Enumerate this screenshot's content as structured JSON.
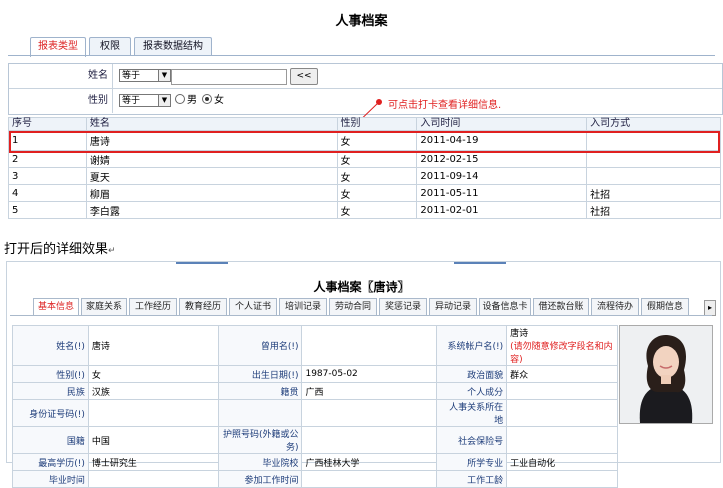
{
  "page_title": "人事档案",
  "tabs": [
    "报表类型",
    "权限",
    "报表数据结构"
  ],
  "search": {
    "name_label": "姓名",
    "name_op": "等于",
    "name_btn": "<<",
    "gender_label": "性别",
    "gender_op": "等于",
    "gender_male": "男",
    "gender_female": "女"
  },
  "callout": "可点击打卡查看详细信息.",
  "table": {
    "headers": [
      "序号",
      "姓名",
      "性别",
      "入司时间",
      "入司方式"
    ],
    "rows": [
      [
        "1",
        "唐诗",
        "女",
        "2011-04-19",
        ""
      ],
      [
        "2",
        "谢婧",
        "女",
        "2012-02-15",
        ""
      ],
      [
        "3",
        "夏天",
        "女",
        "2011-09-14",
        ""
      ],
      [
        "4",
        "柳眉",
        "女",
        "2011-05-11",
        "社招"
      ],
      [
        "5",
        "李白露",
        "女",
        "2011-02-01",
        "社招"
      ]
    ]
  },
  "caption": "打开后的详细效果",
  "detail": {
    "title": "人事档案〖唐诗〗",
    "tabs": [
      "基本信息",
      "家庭关系",
      "工作经历",
      "教育经历",
      "个人证书",
      "培训记录",
      "劳动合同",
      "奖惩记录",
      "异动记录",
      "设备信息卡",
      "借还款台账",
      "流程待办",
      "假期信息"
    ],
    "scroll_arrow": "▸",
    "rows": [
      {
        "l1": "姓名(!)",
        "v1": "唐诗",
        "l2": "曾用名(!)",
        "v2": "",
        "l3": "系统帐户名(!)",
        "v3": "唐诗",
        "v3_note": "(请勿随意修改字段名和内容)"
      },
      {
        "l1": "性别(!)",
        "v1": "女",
        "l2": "出生日期(!)",
        "v2": "1987-05-02",
        "l3": "政治面貌",
        "v3": "群众"
      },
      {
        "l1": "民族",
        "v1": "汉族",
        "l2": "籍贯",
        "v2": "广西",
        "l3": "个人成分",
        "v3": ""
      },
      {
        "l1": "身份证号码(!)",
        "v1": "",
        "l2": "",
        "v2": "",
        "l3": "人事关系所在地",
        "v3": ""
      },
      {
        "l1": "国籍",
        "v1": "中国",
        "l2": "护照号码(外籍或公务)",
        "v2": "",
        "l3": "社会保险号",
        "v3": ""
      },
      {
        "l1": "最高学历(!)",
        "v1": "博士研究生",
        "l2": "毕业院校",
        "v2": "广西桂林大学",
        "l3": "所学专业",
        "v3": "工业自动化"
      },
      {
        "l1": "毕业时间",
        "v1": "",
        "l2": "参加工作时间",
        "v2": "",
        "l3": "工作工龄",
        "v3": ""
      }
    ]
  }
}
